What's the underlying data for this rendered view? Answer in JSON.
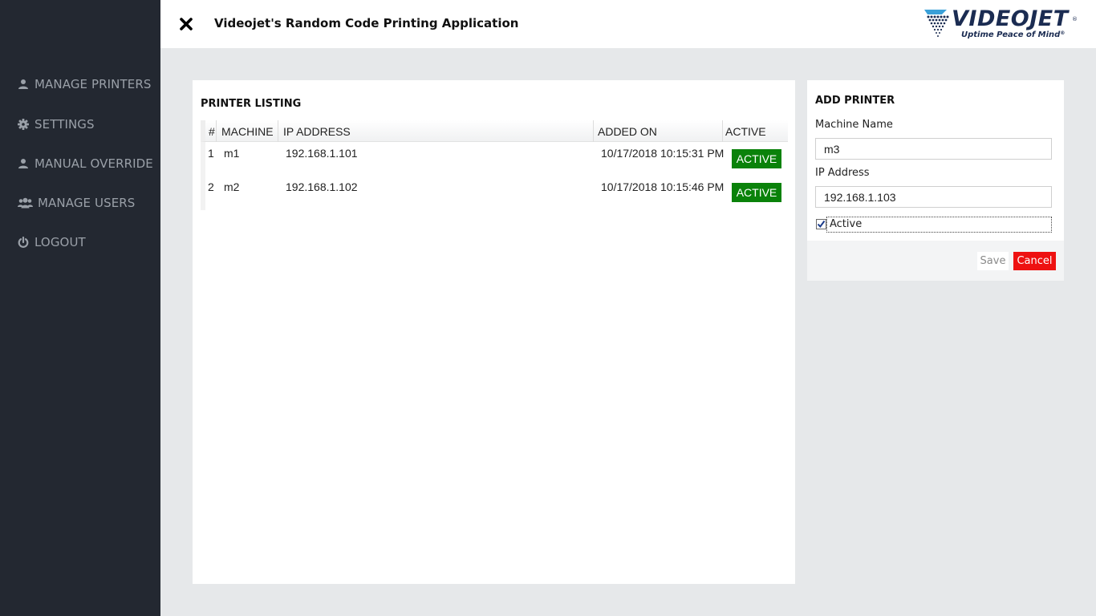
{
  "header": {
    "title": "Videojet's Random Code Printing Application",
    "close_icon": "close-icon",
    "logo": {
      "word": "VIDEOJET",
      "tagline": "Uptime Peace of Mind",
      "registered": "®"
    }
  },
  "sidebar": {
    "items": [
      {
        "label": "MANAGE PRINTERS",
        "icon": "user-icon"
      },
      {
        "label": "SETTINGS",
        "icon": "gear-icon"
      },
      {
        "label": "MANUAL OVERRIDE",
        "icon": "user-icon"
      },
      {
        "label": "MANAGE USERS",
        "icon": "users-icon"
      },
      {
        "label": "LOGOUT",
        "icon": "power-icon"
      }
    ]
  },
  "listing": {
    "title": "PRINTER LISTING",
    "columns": [
      "#",
      "MACHINE",
      "IP ADDRESS",
      "ADDED ON",
      "ACTIVE"
    ],
    "rows": [
      {
        "num": "1",
        "machine": "m1",
        "ip": "192.168.1.101",
        "added_on": "10/17/2018 10:15:31 PM",
        "active": "ACTIVE"
      },
      {
        "num": "2",
        "machine": "m2",
        "ip": "192.168.1.102",
        "added_on": "10/17/2018 10:15:46 PM",
        "active": "ACTIVE"
      }
    ]
  },
  "add_printer": {
    "title": "ADD PRINTER",
    "machine_name_label": "Machine Name",
    "machine_name_value": "m3",
    "ip_label": "IP Address",
    "ip_value": "192.168.1.103",
    "active_label": "Active",
    "active_checked": true,
    "save_label": "Save",
    "cancel_label": "Cancel"
  },
  "colors": {
    "sidebar_bg": "#232831",
    "sidebar_text": "#9aa0a8",
    "content_bg": "#e6e8ea",
    "active_badge": "#0a820a",
    "cancel_button": "#ee1111",
    "logo_blue": "#1b2c52",
    "logo_accent": "#3aa0d8"
  }
}
